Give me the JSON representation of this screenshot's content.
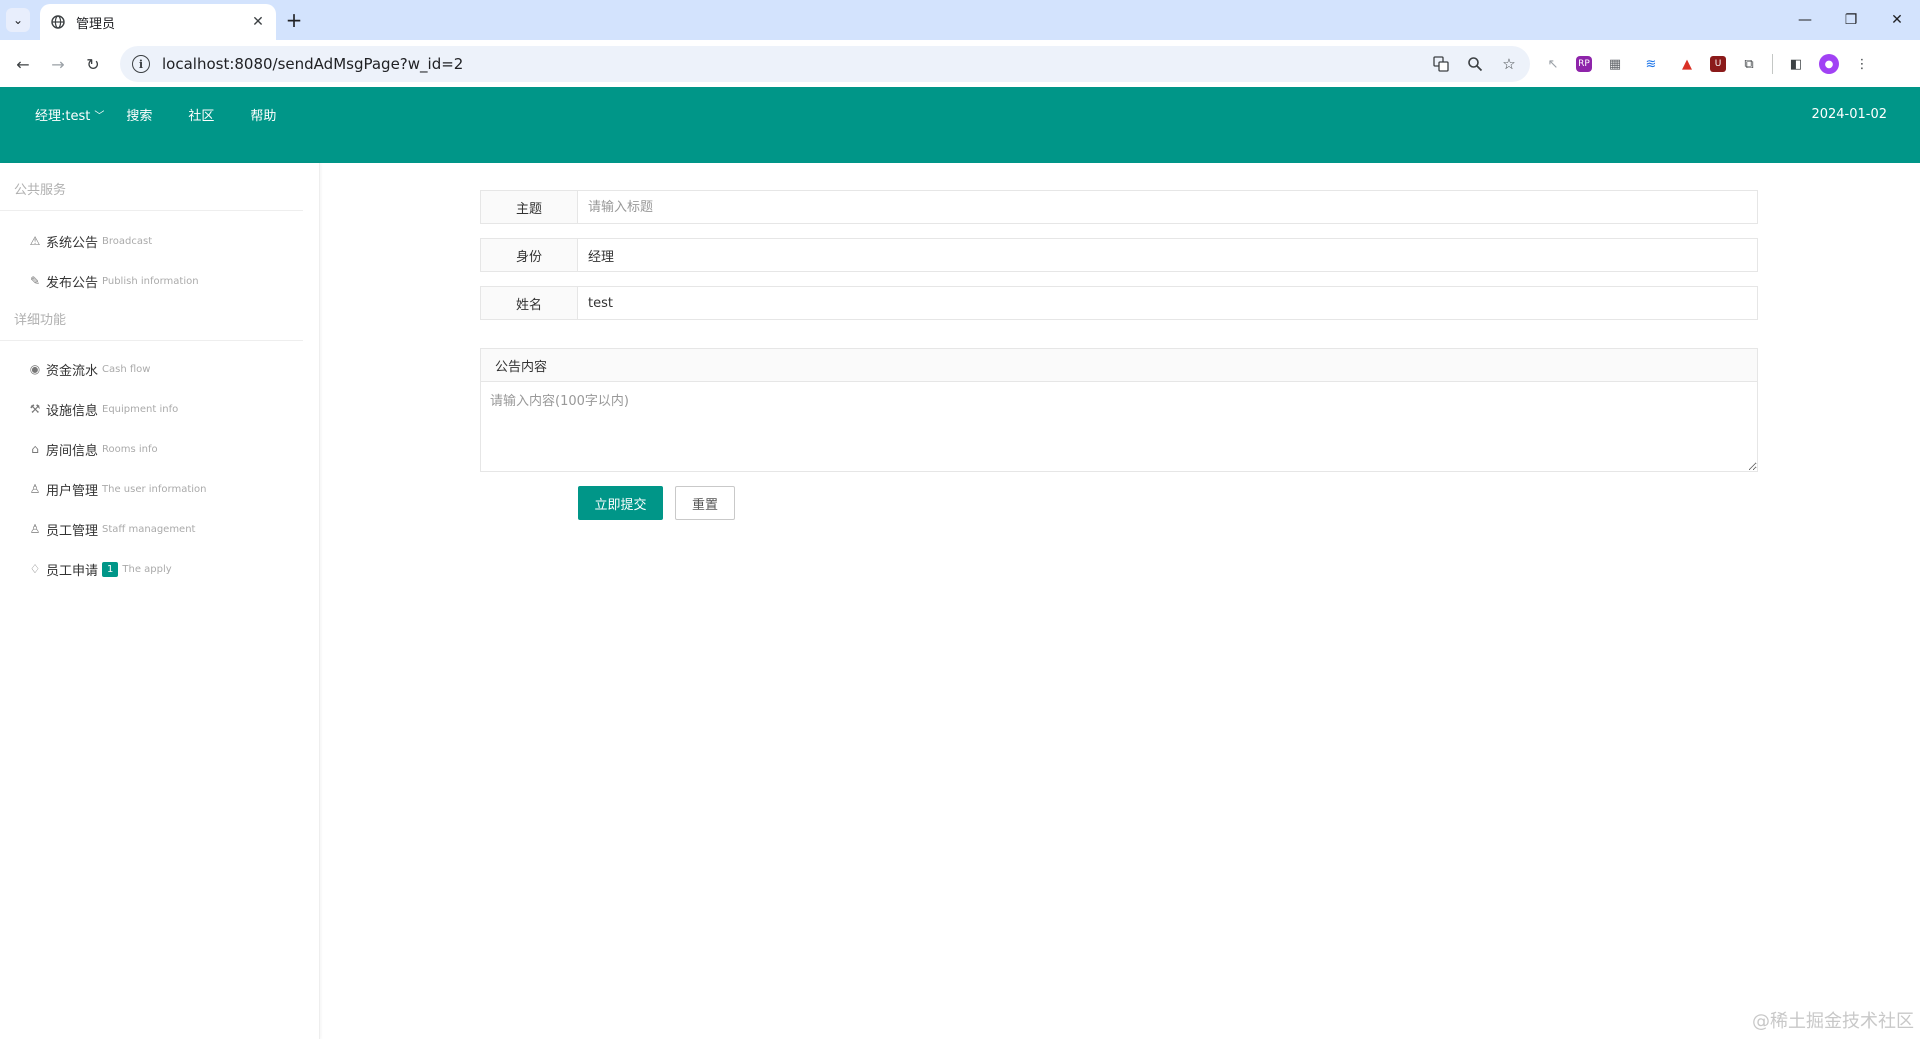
{
  "browser": {
    "tab_title": "管理员",
    "url": "localhost:8080/sendAdMsgPage?w_id=2",
    "icons": [
      "globe-icon",
      "close-icon",
      "plus-icon",
      "back-icon",
      "forward-icon",
      "reload-icon",
      "info-icon",
      "translate-icon",
      "zoom-icon",
      "star-icon"
    ]
  },
  "header": {
    "user_menu": "经理:test",
    "nav": [
      "搜索",
      "社区",
      "帮助"
    ],
    "date": "2024-01-02",
    "accent": "#009688"
  },
  "sidebar": {
    "section1": "公共服务",
    "group1": [
      {
        "label": "系统公告",
        "sub": "Broadcast",
        "icon": "broadcast-icon"
      },
      {
        "label": "发布公告",
        "sub": "Publish information",
        "icon": "edit-icon"
      }
    ],
    "section2": "详细功能",
    "group2": [
      {
        "label": "资金流水",
        "sub": "Cash flow",
        "icon": "cash-icon"
      },
      {
        "label": "设施信息",
        "sub": "Equipment info",
        "icon": "tools-icon"
      },
      {
        "label": "房间信息",
        "sub": "Rooms info",
        "icon": "home-icon"
      },
      {
        "label": "用户管理",
        "sub": "The user information",
        "icon": "user-icon"
      },
      {
        "label": "员工管理",
        "sub": "Staff management",
        "icon": "staff-icon"
      },
      {
        "label": "员工申请",
        "sub": "The apply",
        "icon": "bell-icon",
        "badge": "1"
      }
    ]
  },
  "form": {
    "subject_label": "主题",
    "subject_placeholder": "请输入标题",
    "role_label": "身份",
    "role_value": "经理",
    "name_label": "姓名",
    "name_value": "test",
    "content_label": "公告内容",
    "content_placeholder": "请输入内容(100字以内)",
    "submit_label": "立即提交",
    "reset_label": "重置"
  },
  "watermark": "@稀土掘金技术社区"
}
